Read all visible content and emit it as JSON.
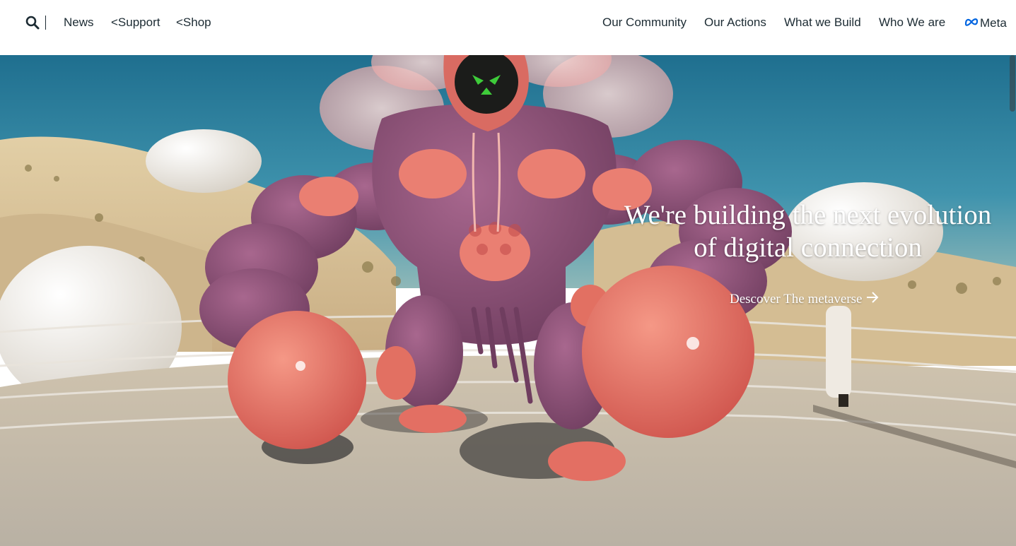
{
  "nav": {
    "left_links": [
      "News",
      "<Support",
      "<Shop"
    ],
    "right_links": [
      "Our Community",
      "Our Actions",
      "What we Build",
      "Who We are"
    ],
    "brand": "Meta",
    "search_icon": "search-icon",
    "logo_icon": "meta-infinity-logo"
  },
  "hero": {
    "headline_line1": "We're building the next evolution",
    "headline_line2": "of digital connection",
    "cta_label": "Descover The metaverse",
    "cta_icon": "arrow-right-icon"
  },
  "colors": {
    "text_dark": "#1c2b33",
    "meta_blue": "#0064e0",
    "sky": "#2d7fa0",
    "sand": "#d9c29a",
    "ring_floor": "#c2b7a6",
    "character_purple": "#8e5277",
    "character_coral": "#e86f63"
  }
}
